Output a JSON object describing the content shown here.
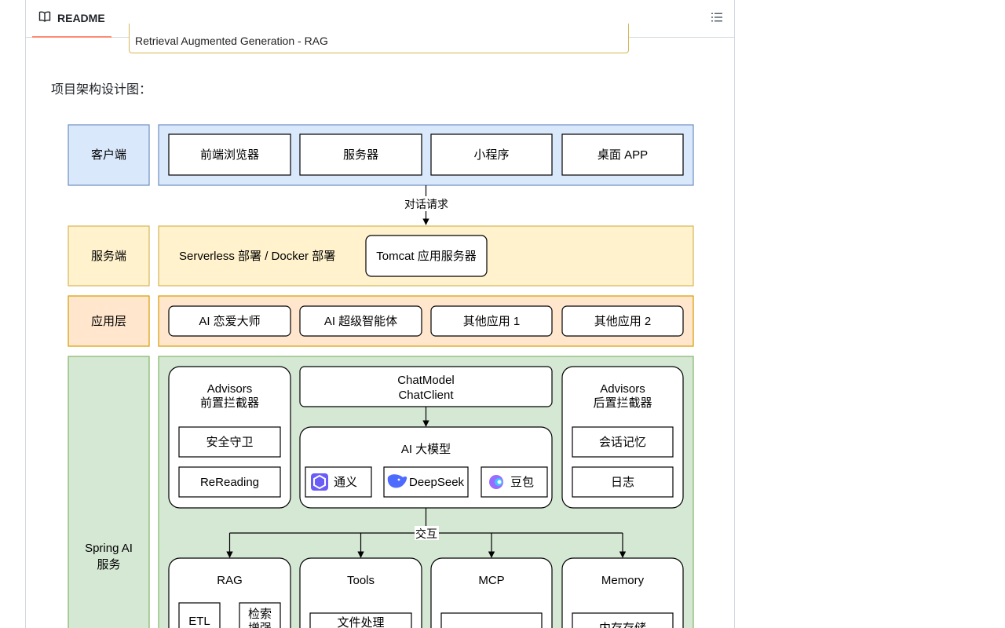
{
  "header": {
    "tab_label": "README",
    "book_icon": "book-icon",
    "outline_icon": "list-unordered-icon"
  },
  "prev_image": {
    "caption": "Retrieval Augmented Generation - RAG"
  },
  "content": {
    "intro": "项目架构设计图："
  },
  "diagram": {
    "client": {
      "label": "客户端",
      "items": [
        "前端浏览器",
        "服务器",
        "小程序",
        "桌面 APP"
      ]
    },
    "request_label": "对话请求",
    "server": {
      "label": "服务端",
      "deploy_text": "Serverless 部署 / Docker 部署",
      "tomcat": "Tomcat 应用服务器"
    },
    "app": {
      "label": "应用层",
      "items": [
        "AI 恋爱大师",
        "AI 超级智能体",
        "其他应用 1",
        "其他应用 2"
      ]
    },
    "spring": {
      "label_line1": "Spring AI",
      "label_line2": "服务",
      "pre_advisors": {
        "title1": "Advisors",
        "title2": "前置拦截器",
        "items": [
          "安全守卫",
          "ReReading"
        ]
      },
      "chat": {
        "line1": "ChatModel",
        "line2": "ChatClient"
      },
      "model": {
        "title": "AI 大模型",
        "items": [
          "通义",
          "DeepSeek",
          "豆包"
        ]
      },
      "post_advisors": {
        "title1": "Advisors",
        "title2": "后置拦截器",
        "items": [
          "会话记忆",
          "日志"
        ]
      },
      "interact_label": "交互",
      "rag": {
        "title": "RAG",
        "items": [
          "ETL",
          "检索",
          "增强"
        ]
      },
      "tools": {
        "title": "Tools",
        "items": [
          "文件处理"
        ]
      },
      "mcp": {
        "title": "MCP"
      },
      "memory": {
        "title": "Memory",
        "items": [
          "内存存储"
        ]
      }
    }
  },
  "colors": {
    "client_fill": "#dae8fc",
    "client_stroke": "#6c8ebf",
    "server_fill": "#fff2cc",
    "server_stroke": "#d6b656",
    "app_fill": "#ffe6cc",
    "app_stroke": "#d79b00",
    "spring_fill": "#d5e8d4",
    "spring_stroke": "#82b366",
    "accent": "#fd8c73"
  }
}
